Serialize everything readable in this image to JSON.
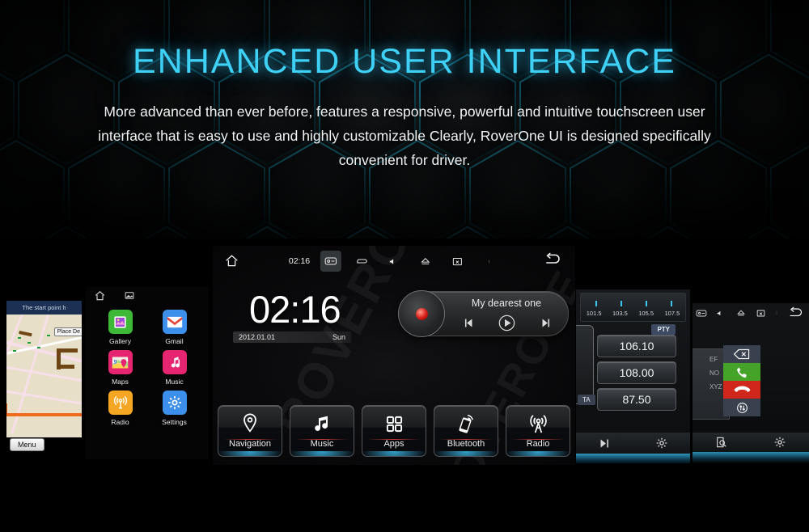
{
  "hero": {
    "title": "ENHANCED USER INTERFACE",
    "subtitle": "More advanced than ever before, features a responsive, powerful and intuitive touchscreen user interface that is easy to use and highly customizable Clearly, RoverOne UI is designed specifically convenient for driver.",
    "accent_color": "#3fd0f5",
    "background_color": "#000000"
  },
  "watermark": {
    "text": "ROVERONE"
  },
  "nav_panel": {
    "title_bar": "The start point h",
    "place_details_label": "Place De",
    "menu_button": "Menu"
  },
  "app_drawer": {
    "status_icons": [
      "home-icon",
      "screenshot-icon"
    ],
    "apps": [
      {
        "label": "Gallery",
        "icon": "gallery-icon",
        "color": "#3db837"
      },
      {
        "label": "Gmail",
        "icon": "gmail-icon",
        "color": "#3c90ec"
      },
      {
        "label": "Maps",
        "icon": "maps-icon",
        "color": "#e5256f"
      },
      {
        "label": "Music",
        "icon": "music-icon",
        "color": "#e5256f"
      },
      {
        "label": "Radio",
        "icon": "radio-icon",
        "color": "#f5a623"
      },
      {
        "label": "Settings",
        "icon": "settings-icon",
        "color": "#3c90ec"
      }
    ]
  },
  "home": {
    "status_bar": {
      "clock": "02:16",
      "icons": [
        "home-icon",
        "sd-card-icon",
        "hazard-icon",
        "volume-icon",
        "eject-icon",
        "close-window-icon",
        "overflow-menu-icon",
        "back-icon"
      ]
    },
    "clock": "02:16",
    "date": "2012.01.01",
    "weekday": "Sun",
    "media_player": {
      "track_title": "My dearest one",
      "controls": [
        "previous-icon",
        "play-icon",
        "next-icon"
      ]
    },
    "shortcuts": [
      {
        "label": "Navigation",
        "icon": "location-pin-icon"
      },
      {
        "label": "Music",
        "icon": "music-note-icon"
      },
      {
        "label": "Apps",
        "icon": "apps-grid-icon"
      },
      {
        "label": "Bluetooth",
        "icon": "phone-bluetooth-icon"
      },
      {
        "label": "Radio",
        "icon": "radio-tower-icon"
      }
    ]
  },
  "radio_panel": {
    "scale_ticks": [
      "101.5",
      "103.5",
      "105.5",
      "107.5"
    ],
    "pty_button": "PTY",
    "ta_button": "TA",
    "presets": [
      "106.10",
      "108.00",
      "87.50"
    ],
    "bottom_icons": [
      "scan-next-icon",
      "gear-icon"
    ]
  },
  "bt_panel": {
    "status_icons": [
      "sd-card-icon",
      "volume-icon",
      "eject-icon",
      "close-window-icon",
      "overflow-menu-icon",
      "back-icon"
    ],
    "keypad_letters": [
      "EF",
      "NO",
      "XYZ"
    ],
    "call_buttons": [
      "backspace-icon",
      "call-answer-icon",
      "call-end-icon",
      "transfer-icon"
    ],
    "bottom_icons": [
      "search-contact-icon",
      "gear-icon"
    ],
    "answer_color": "#46a32a",
    "end_color": "#d0271c"
  }
}
